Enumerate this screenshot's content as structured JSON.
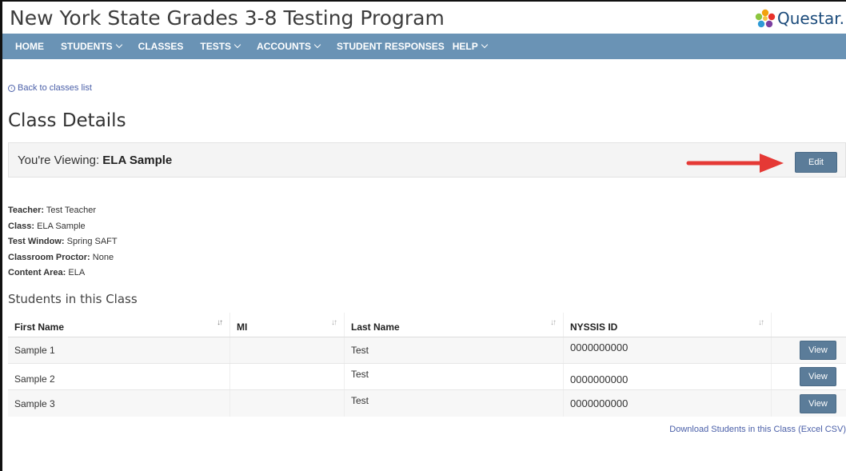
{
  "header": {
    "title": "New York State Grades 3-8 Testing Program",
    "logo_text": "Questar."
  },
  "nav": [
    {
      "label": "HOME",
      "dropdown": false
    },
    {
      "label": "STUDENTS",
      "dropdown": true
    },
    {
      "label": "CLASSES",
      "dropdown": false
    },
    {
      "label": "TESTS",
      "dropdown": true
    },
    {
      "label": "ACCOUNTS",
      "dropdown": true
    },
    {
      "label": "STUDENT RESPONSES",
      "dropdown": false
    },
    {
      "label": "HELP",
      "dropdown": true
    }
  ],
  "back_link": "Back to classes list",
  "page_title": "Class Details",
  "viewing": {
    "prefix": "You're Viewing: ",
    "class_name": "ELA Sample",
    "edit_label": "Edit"
  },
  "details": [
    {
      "label": "Teacher:",
      "value": " Test Teacher"
    },
    {
      "label": "Class:",
      "value": " ELA Sample"
    },
    {
      "label": "Test Window:",
      "value": "  Spring SAFT"
    },
    {
      "label": "Classroom Proctor:",
      "value": " None"
    },
    {
      "label": "Content Area:",
      "value": " ELA"
    }
  ],
  "students_section_title": "Students in this Class",
  "table": {
    "columns": [
      "First Name",
      "MI",
      "Last Name",
      "NYSSIS ID",
      ""
    ],
    "rows": [
      {
        "first": "Sample 1",
        "mi": "",
        "last": "Test",
        "id": "0000000000",
        "action": "View"
      },
      {
        "first": "Sample 2",
        "mi": "",
        "last": "Test",
        "id": "0000000000",
        "action": "View"
      },
      {
        "first": "Sample 3",
        "mi": "",
        "last": "Test",
        "id": "0000000000",
        "action": "View"
      }
    ]
  },
  "download_link": "Download Students in this Class (Excel CSV)",
  "colors": {
    "nav_bg": "#6a93b5",
    "button_bg": "#5b7c99",
    "arrow": "#e53935",
    "link": "#4a5fa8"
  }
}
